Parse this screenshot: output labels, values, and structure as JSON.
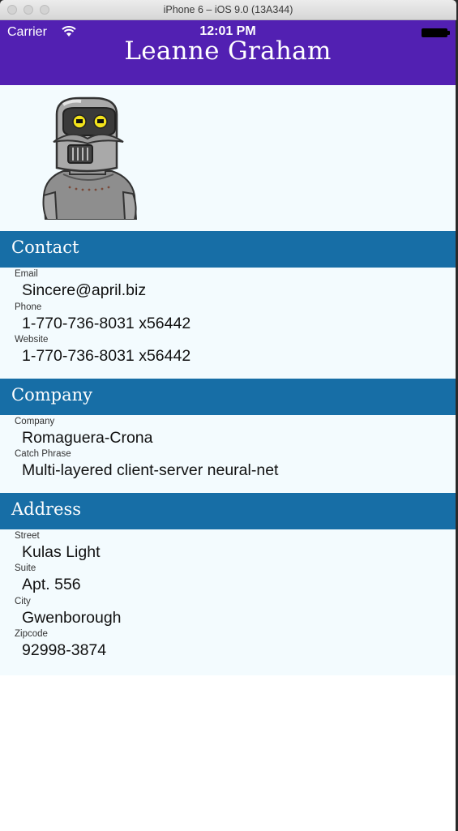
{
  "window": {
    "title": "iPhone 6 – iOS 9.0 (13A344)"
  },
  "status_bar": {
    "carrier": "Carrier",
    "time": "12:01 PM"
  },
  "navbar": {
    "title": "Leanne Graham",
    "background": "#5220b2"
  },
  "avatar": {
    "icon": "robot-avatar-icon"
  },
  "sections": {
    "contact": {
      "title": "Contact",
      "email_label": "Email",
      "email": "Sincere@april.biz",
      "phone_label": "Phone",
      "phone": "1-770-736-8031 x56442",
      "website_label": "Website",
      "website": "1-770-736-8031 x56442"
    },
    "company": {
      "title": "Company",
      "company_label": "Company",
      "company": "Romaguera-Crona",
      "catch_label": "Catch Phrase",
      "catch": "Multi-layered client-server neural-net"
    },
    "address": {
      "title": "Address",
      "street_label": "Street",
      "street": "Kulas Light",
      "suite_label": "Suite",
      "suite": "Apt. 556",
      "city_label": "City",
      "city": "Gwenborough",
      "zip_label": "Zipcode",
      "zip": "92998-3874"
    }
  },
  "colors": {
    "section_header": "#176ea6",
    "content_bg": "#f3fbfe"
  }
}
